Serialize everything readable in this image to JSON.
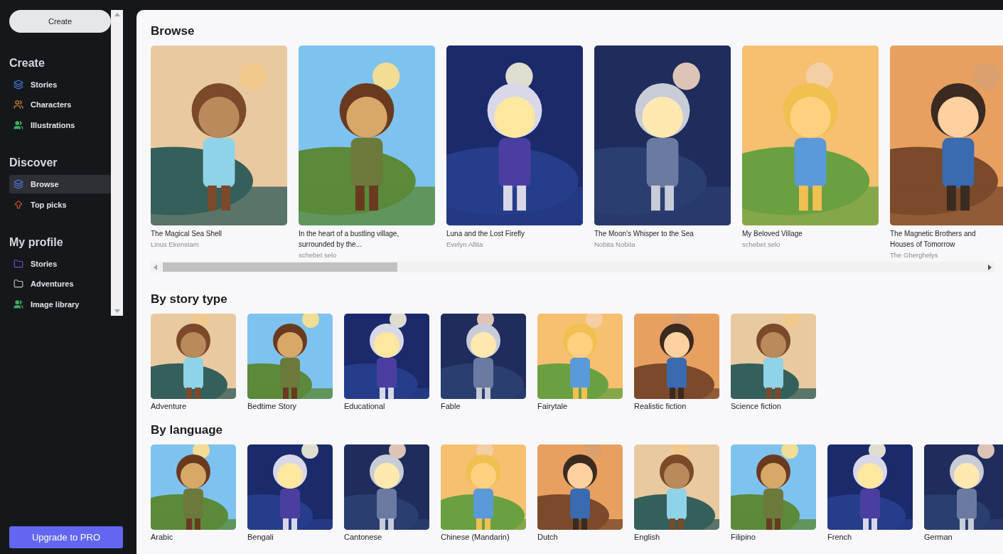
{
  "sidebar": {
    "create_button": "Create",
    "sections": [
      {
        "title": "Create",
        "items": [
          {
            "label": "Stories",
            "kind": "stories",
            "selected": false
          },
          {
            "label": "Characters",
            "kind": "characters",
            "selected": false
          },
          {
            "label": "Illustrations",
            "kind": "illustrations",
            "selected": false
          }
        ]
      },
      {
        "title": "Discover",
        "items": [
          {
            "label": "Browse",
            "kind": "stories",
            "selected": true
          },
          {
            "label": "Top picks",
            "kind": "top",
            "selected": false
          }
        ]
      },
      {
        "title": "My profile",
        "items": [
          {
            "label": "Stories",
            "kind": "folder",
            "selected": false
          },
          {
            "label": "Adventures",
            "kind": "folder-plain",
            "selected": false
          },
          {
            "label": "Image library",
            "kind": "illustrations",
            "selected": false
          }
        ]
      }
    ],
    "upgrade_button": "Upgrade to PRO"
  },
  "main": {
    "sections": [
      {
        "title": "Browse",
        "kind": "cards",
        "items": [
          {
            "title": "The Magical Sea Shell",
            "author": "Linus Ekenstam"
          },
          {
            "title": "In the heart of a bustling village, surrounded by the...",
            "author": "schebet selo"
          },
          {
            "title": "Luna and the Lost Firefly",
            "author": "Evelyn Allita"
          },
          {
            "title": "The Moon's Whisper to the Sea",
            "author": "Nobita Nobita"
          },
          {
            "title": "My Beloved Village",
            "author": "schebet selo"
          },
          {
            "title": "The Magnetic Brothers and Houses of Tomorrow",
            "author": "The Gherghelys"
          }
        ]
      },
      {
        "title": "By story type",
        "kind": "tiles",
        "items": [
          {
            "label": "Adventure"
          },
          {
            "label": "Bedtime Story"
          },
          {
            "label": "Educational"
          },
          {
            "label": "Fable"
          },
          {
            "label": "Fairytale"
          },
          {
            "label": "Realistic fiction"
          },
          {
            "label": "Science fiction"
          }
        ]
      },
      {
        "title": "By language",
        "kind": "tiles",
        "items": [
          {
            "label": "Arabic"
          },
          {
            "label": "Bengali"
          },
          {
            "label": "Cantonese"
          },
          {
            "label": "Chinese (Mandarin)"
          },
          {
            "label": "Dutch"
          },
          {
            "label": "English"
          },
          {
            "label": "Filipino"
          },
          {
            "label": "French"
          },
          {
            "label": "German"
          }
        ]
      }
    ]
  }
}
